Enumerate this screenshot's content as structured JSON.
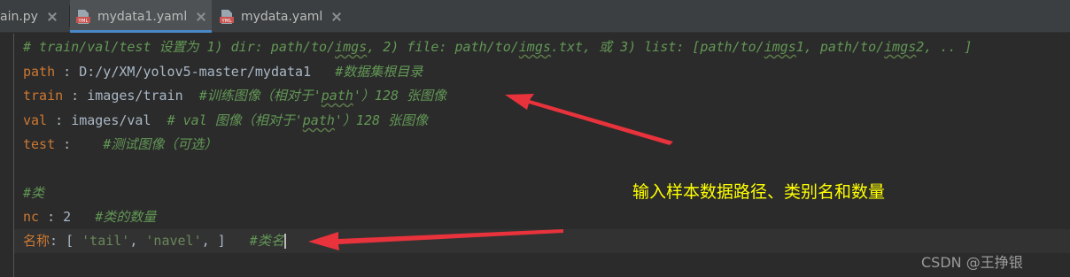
{
  "tabs": [
    {
      "label": "ain.py",
      "active": false
    },
    {
      "label": "mydata1.yaml",
      "active": true
    },
    {
      "label": "mydata.yaml",
      "active": false
    }
  ],
  "editor": {
    "line1": {
      "comment_a": "# train/val/test 设置为 1) dir: path/to/",
      "w1": "imgs",
      "comment_b": ", 2) file: path/to/",
      "w2": "imgs",
      "comment_c": ".txt, 或 3) list: [path/to/",
      "w3": "imgs",
      "comment_d": "1, path/to/",
      "w4": "imgs",
      "comment_e": "2, .. ]"
    },
    "line2": {
      "key": "path",
      "sep": " : ",
      "value": "D:/y/XM/yolov5-master/mydata1",
      "comment": "#数据集根目录"
    },
    "line3": {
      "key": "train",
      "sep": " : ",
      "value": "images/train",
      "comment_a": "#训练图像（相对于'",
      "w": "path",
      "comment_b": "'）128 张图像"
    },
    "line4": {
      "key": "val",
      "sep": " : ",
      "value": "images/val",
      "comment_a": "# val 图像（相对于'",
      "w": "path",
      "comment_b": "'）128 张图像"
    },
    "line5": {
      "key": "test",
      "sep": " : ",
      "comment": "#测试图像（可选）"
    },
    "line7": {
      "comment": "#类"
    },
    "line8": {
      "key": "nc",
      "sep": " : ",
      "value": "2",
      "comment": "#类的数量"
    },
    "line9": {
      "key": "名称",
      "sep": ": [ ",
      "s1": "'tail'",
      "comma1": ", ",
      "s2": "'navel'",
      "tail": ", ]",
      "comment_a": "#类",
      "comment_b": "名"
    }
  },
  "annotation": {
    "text": "输入样本数据路径、类别名和数量",
    "color": "#ffff00"
  },
  "watermark": {
    "text": "CSDN @王挣银"
  },
  "colors": {
    "background": "#2b2b2b",
    "key": "#cc7832",
    "comment": "#629755",
    "string": "#6a8759",
    "arrow": "#e8323c"
  }
}
